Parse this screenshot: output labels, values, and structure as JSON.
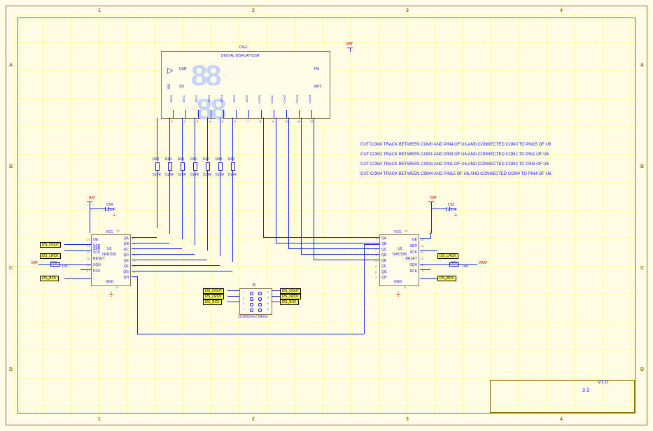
{
  "title_block": {
    "sheet": "3  3",
    "ver": "V1.0"
  },
  "border": {
    "cols": [
      "1",
      "2",
      "3",
      "4"
    ],
    "rows": [
      "A",
      "B",
      "C",
      "D"
    ]
  },
  "display": {
    "ref": "DIG1",
    "part": "DIGITAL-DISPLAY-COM",
    "icons": [
      "▷",
      "||"
    ],
    "labels": [
      "USB",
      "SD",
      "FM",
      "MP3"
    ],
    "pins": [
      "SEG0",
      "SEG1",
      "SEG2",
      "SEG3",
      "SEG4",
      "SEG5",
      "SEG6",
      "COM0",
      "COM1",
      "COM2",
      "COM3",
      "COM4"
    ],
    "nums": [
      "1",
      "2",
      "3",
      "4",
      "5",
      "6",
      "7",
      "8",
      "9",
      "10",
      "11",
      "12"
    ]
  },
  "resistors": {
    "refs": [
      "R63",
      "R64",
      "R65",
      "R66",
      "R67",
      "R68",
      "R69"
    ],
    "val": "510R"
  },
  "caps": {
    "c54": {
      "ref": "C54",
      "val": "0.1uF"
    },
    "c53": {
      "ref": "C53",
      "val": "0.1uF"
    }
  },
  "u5": {
    "ref": "U5",
    "part": "74HC595",
    "side": "SER",
    "left_pins": [
      "13",
      "14",
      "11",
      "10",
      "12",
      "9"
    ],
    "left_names": [
      "OE",
      "SER",
      "SCK",
      "RESET",
      "SQH",
      "RCK"
    ],
    "right_pins": [
      "15",
      "1",
      "2",
      "3",
      "4",
      "5",
      "6",
      "7"
    ],
    "right_names": [
      "QA",
      "QB",
      "QC",
      "QD",
      "QE",
      "QF",
      "QG",
      "QH"
    ],
    "vcc_pin": "16",
    "gnd_pin": "8"
  },
  "u6": {
    "ref": "U6",
    "part": "74HC595",
    "left_pins": [
      "15",
      "1",
      "2",
      "3",
      "4",
      "5",
      "6",
      "7"
    ],
    "left_names": [
      "QA",
      "QB",
      "QC",
      "QD",
      "QE",
      "QF",
      "QG",
      "QH"
    ],
    "right_pins": [
      "13",
      "14",
      "11",
      "10",
      "12",
      "9"
    ],
    "right_names": [
      "OE",
      "SER",
      "SCK",
      "RESET",
      "SQH",
      "RCK"
    ],
    "vcc_pin": "16",
    "gnd_pin": "8"
  },
  "j6": {
    "ref": "J6",
    "part": "1CON2X4-2.54mm",
    "pins": [
      "1",
      "2",
      "3",
      "4",
      "5",
      "6",
      "7",
      "8"
    ]
  },
  "r70": {
    "ref": "R70",
    "val": "10K"
  },
  "r71": {
    "ref": "R71",
    "val": "10K"
  },
  "nets": {
    "i2s_dout": "I2S_DOUT",
    "i2s_lrck": "I2S_LRCK",
    "i2s_bck": "I2S_BCK"
  },
  "pwr": {
    "bat": "BAT",
    "vbat": "VBAT",
    "vcc": "VCC",
    "gnd": "GND"
  },
  "notes": [
    "CUT COM0 TRACK BETWEEN COM0 AND PIN4 OF U6,AND CONNECTED COM0 TO PIN15 OF U6",
    "CUT COM1 TRACK BETWEEN COM1 AND PIN3 OF U6,AND CONNECTED COM1 TO PIN1 OF U6",
    "CUT COM3 TRACK BETWEEN COM3 AND PIN1 OF U6,AND CONNECTED COM3 TO PIN3 OF U6",
    "CUT COM4 TRACK BETWEEN COM4 AND PIN15 OF U6,AND CONNECTED COM4 TO PIN4 OF U6"
  ]
}
